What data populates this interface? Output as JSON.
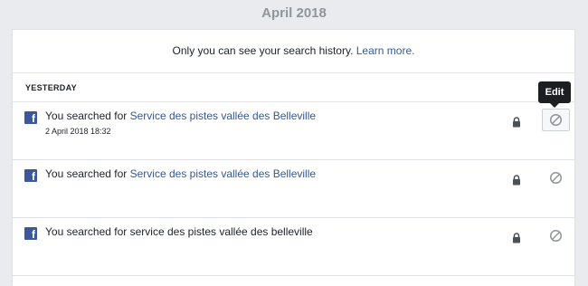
{
  "month_header": "April 2018",
  "privacy_note": {
    "text": "Only you can see your search history. ",
    "link": "Learn more."
  },
  "section": {
    "label": "YESTERDAY"
  },
  "tooltip": "Edit",
  "entries": [
    {
      "prefix": "You searched for ",
      "query_linked": "Service des pistes vallée des Belleville",
      "query_plain": "",
      "timestamp": "2 April 2018 18:32"
    },
    {
      "prefix": "You searched for ",
      "query_linked": "Service des pistes vallée des Belleville",
      "query_plain": "",
      "timestamp": ""
    },
    {
      "prefix": "You searched for ",
      "query_linked": "",
      "query_plain": "service des pistes vallée des belleville",
      "timestamp": ""
    }
  ],
  "icons": {
    "source": "facebook-icon",
    "privacy": "lock-icon",
    "edit": "hide-circle-slash-icon"
  },
  "colors": {
    "link": "#365899",
    "facebook_blue": "#3b5998",
    "text": "#1d2129",
    "muted_header": "#90949c"
  }
}
